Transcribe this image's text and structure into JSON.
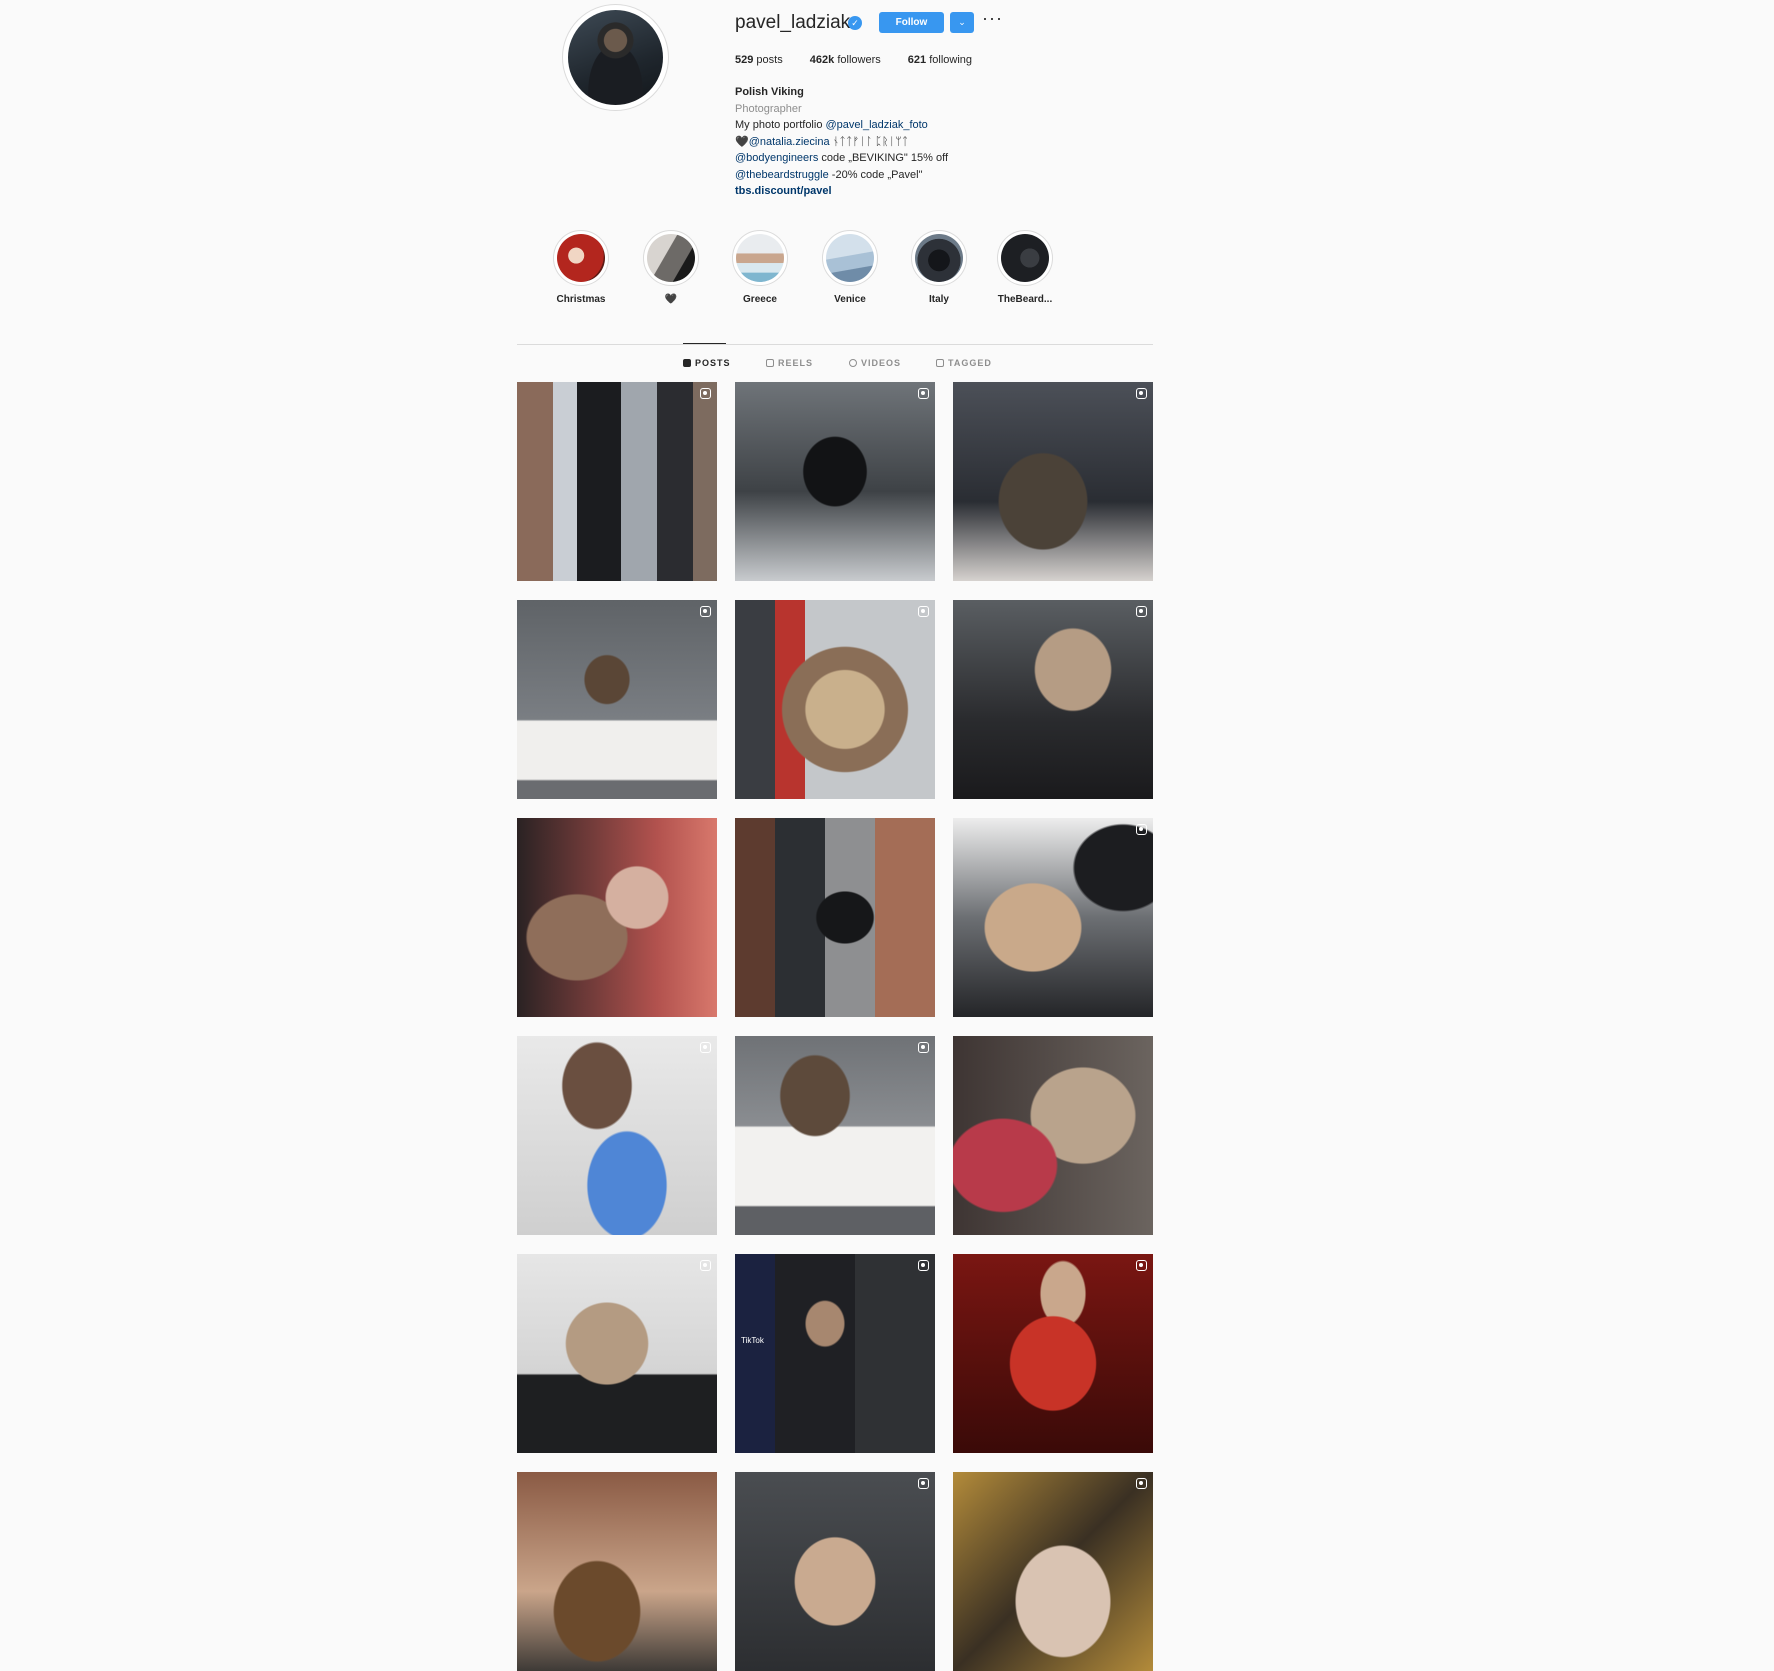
{
  "profile": {
    "username": "pavel_ladziak",
    "follow_label": "Follow",
    "more_label": "···",
    "stats": {
      "posts_value": "529",
      "posts_label": "posts",
      "followers_value": "462k",
      "followers_label": "followers",
      "following_value": "621",
      "following_label": "following"
    },
    "bio": {
      "name": "Polish Viking",
      "category": "Photographer",
      "line1_text": "My photo portfolio ",
      "line1_link": "@pavel_ladziak_foto",
      "line2_heart": "🖤",
      "line2_link": "@natalia.ziecina",
      "line2_runes": " ᚾᛏᛏᚠᛁᛚ ᛈᚱᛁᛘᛏ",
      "line3_link": "@bodyengineers",
      "line3_text": " code „BEVIKING\" 15% off",
      "line4_link": "@thebeardstruggle",
      "line4_text": " -20% code „Pavel\"",
      "website": "tbs.discount/pavel"
    }
  },
  "highlights": [
    {
      "label": "Christmas",
      "color": "#b3261e"
    },
    {
      "label": "🖤",
      "color": "#6d6a67"
    },
    {
      "label": "Greece",
      "color": "#c9a68e"
    },
    {
      "label": "Venice",
      "color": "#a9c1d6"
    },
    {
      "label": "Italy",
      "color": "#2d3138"
    },
    {
      "label": "TheBeard...",
      "color": "#1d1f23"
    }
  ],
  "tabs": [
    {
      "label": "POSTS",
      "active": true
    },
    {
      "label": "REELS",
      "active": false
    },
    {
      "label": "VIDEOS",
      "active": false
    },
    {
      "label": "TAGGED",
      "active": false
    }
  ],
  "tiktok_label": "TikTok",
  "accent_color": "#3897f0"
}
